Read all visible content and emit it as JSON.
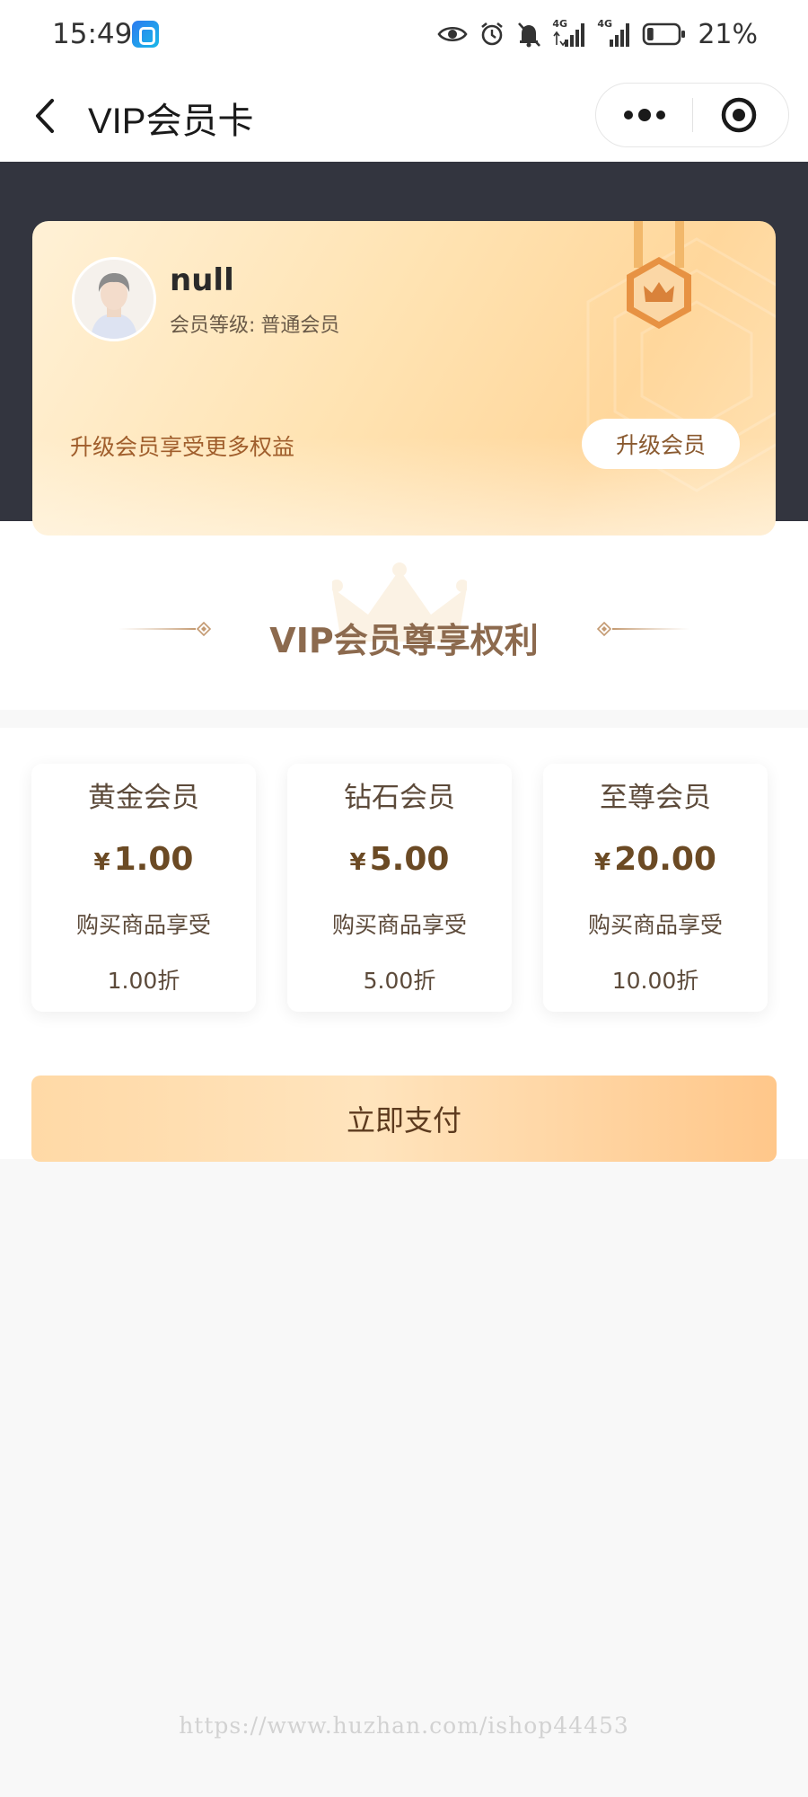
{
  "status_bar": {
    "time": "15:49",
    "network_1": "4G",
    "network_2": "4G",
    "battery_percent": "21%",
    "battery_level": 0.21
  },
  "nav": {
    "title": "VIP会员卡"
  },
  "user": {
    "name": "null",
    "level_label": "会员等级:",
    "level_value": "普通会员"
  },
  "card": {
    "upgrade_tip": "升级会员享受更多权益",
    "upgrade_button": "升级会员"
  },
  "privileges": {
    "title": "VIP会员尊享权利"
  },
  "tiers": [
    {
      "name": "黄金会员",
      "currency": "¥",
      "price": "1.00",
      "benefit": "购买商品享受",
      "discount": "1.00折"
    },
    {
      "name": "钻石会员",
      "currency": "¥",
      "price": "5.00",
      "benefit": "购买商品享受",
      "discount": "5.00折"
    },
    {
      "name": "至尊会员",
      "currency": "¥",
      "price": "20.00",
      "benefit": "购买商品享受",
      "discount": "10.00折"
    }
  ],
  "pay_button": "立即支付",
  "watermark": "https://www.huzhan.com/ishop44453",
  "colors": {
    "header_dark": "#33353f",
    "card_gold": "#ffe3b2",
    "accent_brown": "#8c6a4e",
    "pay_gradient_start": "#ffd9a6",
    "pay_gradient_end": "#ffc78a"
  }
}
